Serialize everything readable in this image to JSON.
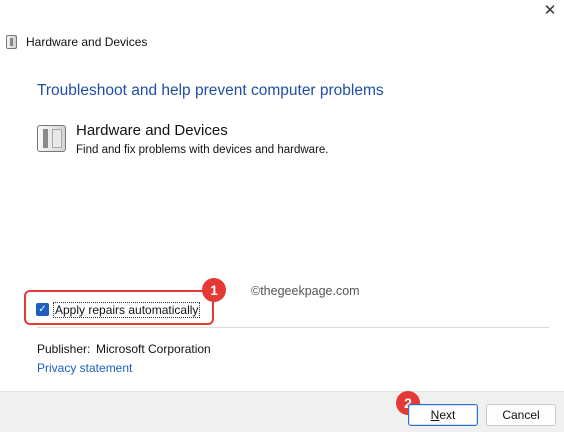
{
  "window": {
    "close_glyph": "✕",
    "title": "Hardware and Devices"
  },
  "main": {
    "heading": "Troubleshoot and help prevent computer problems",
    "item_title": "Hardware and Devices",
    "item_description": "Find and fix problems with devices and hardware."
  },
  "watermark": "©thegeekpage.com",
  "annotations": [
    {
      "number": "1"
    },
    {
      "number": "2"
    }
  ],
  "options": {
    "apply_repairs_label": "Apply repairs automatically",
    "apply_repairs_checked": true
  },
  "info": {
    "publisher_label": "Publisher:",
    "publisher_value": "Microsoft Corporation",
    "privacy_link": "Privacy statement"
  },
  "footer": {
    "next_label_rest": "ext",
    "next_label_accel": "N",
    "cancel_label": "Cancel"
  },
  "colors": {
    "accent": "#1f5fbf",
    "heading": "#1e4fa3",
    "annotation": "#e53935"
  },
  "icons": {
    "title_icon": "hardware-devices-icon",
    "item_icon": "hardware-devices-icon",
    "checkmark": "✓"
  }
}
